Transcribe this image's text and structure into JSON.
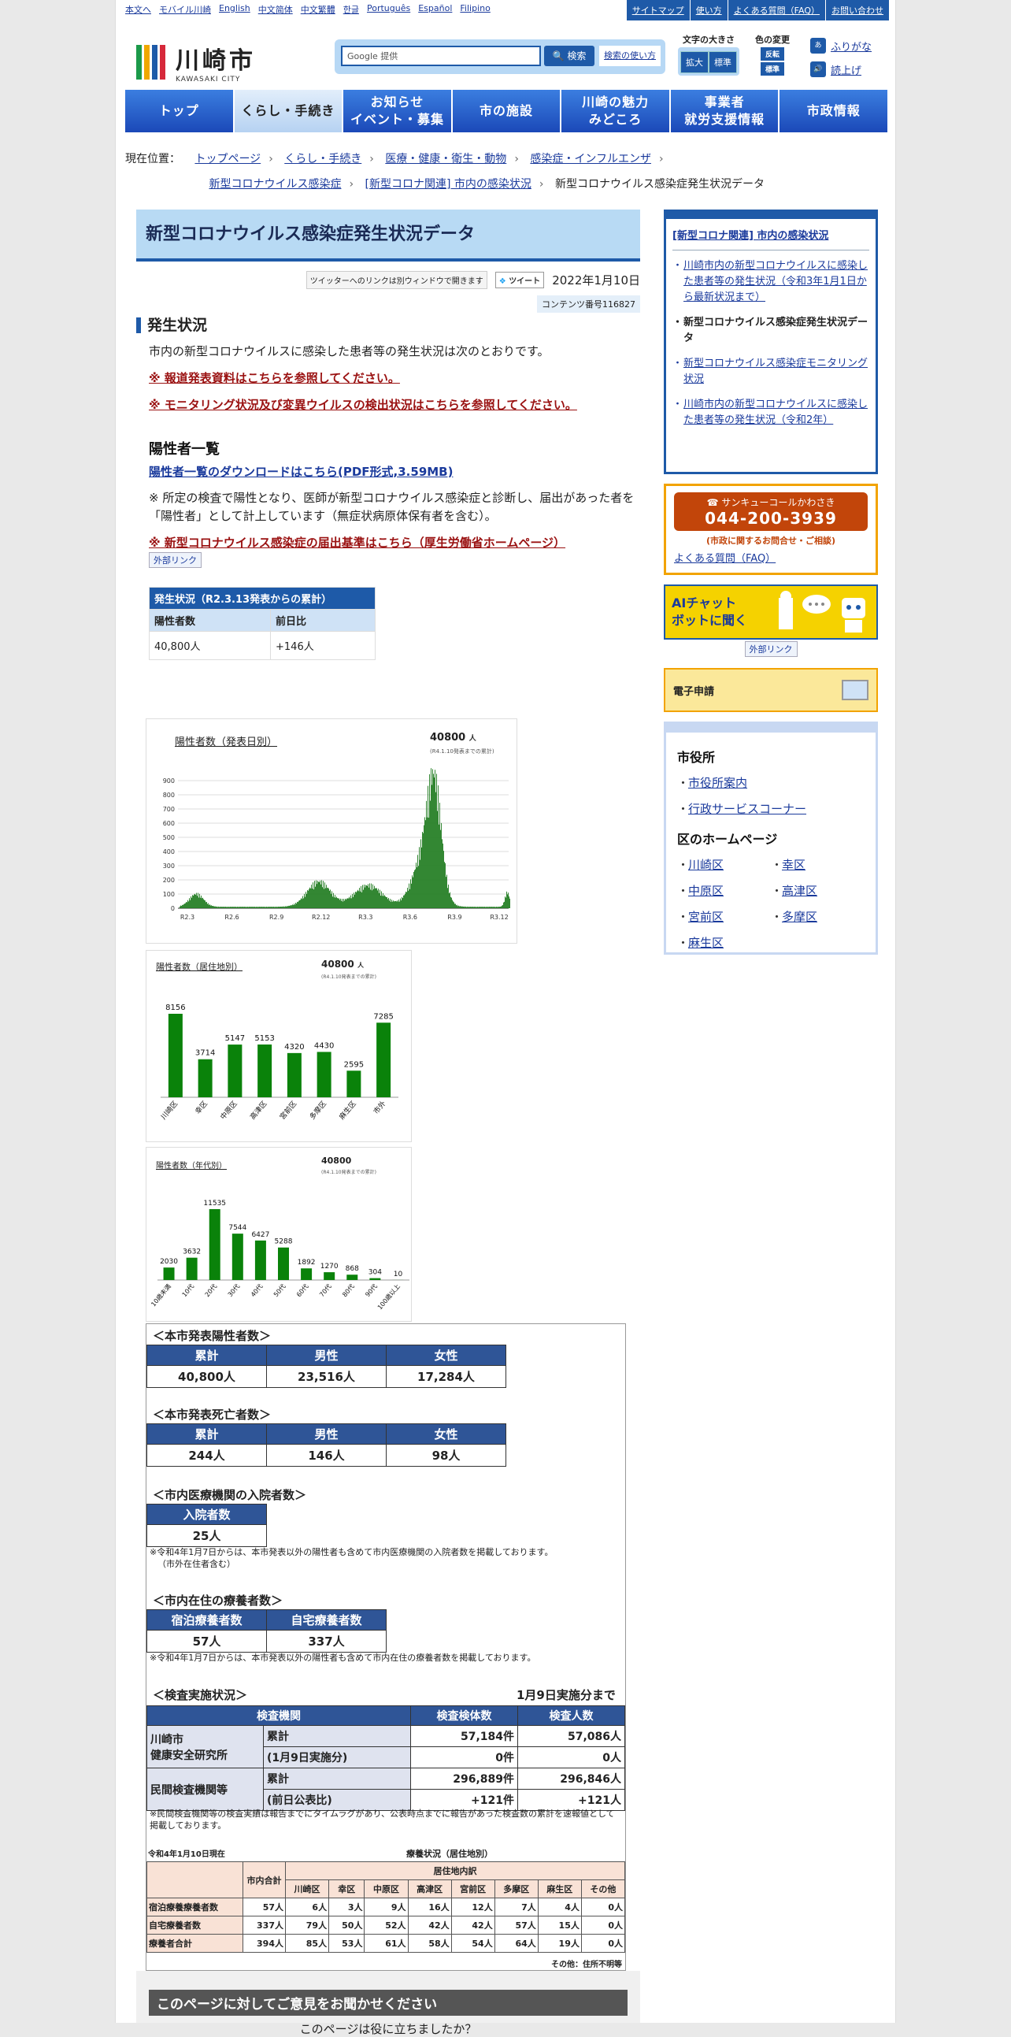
{
  "utility": {
    "left": [
      "本文へ",
      "モバイル川崎",
      "English",
      "中文简体",
      "中文繁體",
      "한글",
      "Português",
      "Español",
      "Filipino"
    ],
    "right": [
      "サイトマップ",
      "使い方",
      "よくある質問（FAQ）",
      "お問い合わせ"
    ]
  },
  "logo": {
    "name": "川崎市",
    "sub": "KAWASAKI CITY"
  },
  "search": {
    "placeholder": "Google 提供",
    "button": "検索",
    "help": "検索の使い方"
  },
  "fontsize": {
    "title": "文字の大きさ",
    "large": "拡大",
    "standard": "標準"
  },
  "colorchange": {
    "title": "色の変更",
    "reverse": "反転",
    "standard": "標準"
  },
  "ruby": {
    "furigana": "ふりがな",
    "read": "読上げ"
  },
  "nav": [
    "トップ",
    "くらし・手続き",
    "お知らせ\nイベント・募集",
    "市の施設",
    "川崎の魅力\nみどころ",
    "事業者\n就労支援情報",
    "市政情報"
  ],
  "breadcrumb": {
    "label": "現在位置：",
    "items": [
      "トップページ",
      "くらし・手続き",
      "医療・健康・衛生・動物",
      "感染症・インフルエンザ",
      "新型コロナウイルス感染症",
      "[新型コロナ関連] 市内の感染状況"
    ],
    "current": "新型コロナウイルス感染症発生状況データ"
  },
  "page": {
    "title": "新型コロナウイルス感染症発生状況データ",
    "twitter_note": "ツイッターへのリンクは別ウィンドウで開きます",
    "tweet": "ツイート",
    "date": "2022年1月10日",
    "content_no": "コンテンツ番号116827"
  },
  "status": {
    "heading": "発生状況",
    "intro": "市内の新型コロナウイルスに感染した患者等の発生状況は次のとおりです。",
    "link1": "※ 報道発表資料はこちらを参照してください。",
    "link2": "※ モニタリング状況及び変異ウイルスの検出状況はこちらを参照してください。"
  },
  "positive": {
    "heading": "陽性者一覧",
    "download": "陽性者一覧のダウンロードはこちら(PDF形式,3.59MB)",
    "note": "※ 所定の検査で陽性となり、医師が新型コロナウイルス感染症と診断し、届出があった者を「陽性者」として計上しています（無症状病原体保有者を含む）。",
    "criteria": "※ 新型コロナウイルス感染症の届出基準はこちら（厚生労働省ホームページ）",
    "ext": "外部リンク"
  },
  "summary": {
    "caption": "発生状況（R2.3.13発表からの累計）",
    "h1": "陽性者数",
    "h2": "前日比",
    "v1": "40,800人",
    "v2": "+146人"
  },
  "chart_data": [
    {
      "type": "bar",
      "title": "陽性者数（発表日別）",
      "total": "40800",
      "unit": "人",
      "note": "(R4.1.10発表までの累計)",
      "categories": [
        "R2.3",
        "R2.6",
        "R2.9",
        "R2.12",
        "R3.3",
        "R3.6",
        "R3.9",
        "R3.12"
      ],
      "ylim": [
        0,
        900
      ],
      "yticks": [
        0,
        100,
        200,
        300,
        400,
        500,
        600,
        700,
        800,
        900
      ]
    },
    {
      "type": "bar",
      "title": "陽性者数（居住地別）",
      "total": "40800",
      "unit": "人",
      "note": "(R4.1.10発表までの累計)",
      "categories": [
        "川崎区",
        "幸区",
        "中原区",
        "高津区",
        "宮前区",
        "多摩区",
        "麻生区",
        "市外"
      ],
      "values": [
        8156,
        3714,
        5147,
        5153,
        4320,
        4430,
        2595,
        7285
      ]
    },
    {
      "type": "bar",
      "title": "陽性者数（年代別）",
      "total": "40800",
      "unit": "人",
      "note": "(R4.1.10発表までの累計)",
      "categories": [
        "10歳未満",
        "10代",
        "20代",
        "30代",
        "40代",
        "50代",
        "60代",
        "70代",
        "80代",
        "90代",
        "100歳以上"
      ],
      "values": [
        2030,
        3632,
        11535,
        7544,
        6427,
        5288,
        1892,
        1270,
        868,
        304,
        10
      ]
    }
  ],
  "tables": {
    "pos": {
      "title": "＜本市発表陽性者数＞",
      "h": [
        "累計",
        "男性",
        "女性"
      ],
      "v": [
        "40,800人",
        "23,516人",
        "17,284人"
      ]
    },
    "death": {
      "title": "＜本市発表死亡者数＞",
      "h": [
        "累計",
        "男性",
        "女性"
      ],
      "v": [
        "244人",
        "146人",
        "98人"
      ]
    },
    "hosp": {
      "title": "＜市内医療機関の入院者数＞",
      "h": "入院者数",
      "v": "25人",
      "note": "※令和4年1月7日からは、本市発表以外の陽性者も含めて市内医療機関の入院者数を掲載しております。",
      "note2": "（市外在住者含む）"
    },
    "care": {
      "title": "＜市内在住の療養者数＞",
      "h": [
        "宿泊療養者数",
        "自宅療養者数"
      ],
      "v": [
        "57人",
        "337人"
      ],
      "note": "※令和4年1月7日からは、本市発表以外の陽性者も含めて市内在住の療養者数を掲載しております。"
    },
    "test": {
      "title": "＜検査実施状況＞",
      "asof": "1月9日実施分まで",
      "h": [
        "検査機関",
        "検査検体数",
        "検査人数"
      ],
      "org1": "川崎市\n健康安全研究所",
      "org2": "民間検査機関等",
      "sub": [
        "累計",
        "(1月9日実施分)",
        "累計",
        "(前日公表比)"
      ],
      "vals": [
        [
          "57,184件",
          "57,086人"
        ],
        [
          "0件",
          "0人"
        ],
        [
          "296,889件",
          "296,846人"
        ],
        [
          "+121件",
          "+121人"
        ]
      ],
      "note": "※民間検査機関等の検査実績は報告までにタイムラグがあり、公表時点までに報告があった検査数の累計を速報値として掲載しております。"
    },
    "city": {
      "asof": "令和4年1月10日現在",
      "title": "療養状況（居住地別）",
      "total": "市内合計",
      "breakdown": "居住地内訳",
      "cols": [
        "川崎区",
        "幸区",
        "中原区",
        "高津区",
        "宮前区",
        "多摩区",
        "麻生区",
        "その他"
      ],
      "rows": [
        {
          "label": "宿泊療養療養者数",
          "v": [
            "57人",
            "6人",
            "3人",
            "9人",
            "16人",
            "12人",
            "7人",
            "4人",
            "0人"
          ]
        },
        {
          "label": "自宅療養者数",
          "v": [
            "337人",
            "79人",
            "50人",
            "52人",
            "42人",
            "42人",
            "57人",
            "15人",
            "0人"
          ]
        },
        {
          "label": "療養者合計",
          "v": [
            "394人",
            "85人",
            "53人",
            "61人",
            "58人",
            "54人",
            "64人",
            "19人",
            "0人"
          ]
        }
      ],
      "foot": "その他：住所不明等"
    }
  },
  "feedback": {
    "head": "このページに対してご意見をお聞かせください",
    "sub": "このページは役に立ちましたか？"
  },
  "side": {
    "rel_head": "[新型コロナ関連] 市内の感染状況",
    "rel_items": [
      "川崎市内の新型コロナウイルスに感染した患者等の発生状況（令和3年1月1日から最新状況まで）",
      "新型コロナウイルス感染症発生状況データ",
      "新型コロナウイルス感染症モニタリング状況",
      "川崎市内の新型コロナウイルスに感染した患者等の発生状況（令和2年）"
    ],
    "sunq_name": "サンキューコールかわさき",
    "sunq_tel": "044-200-3939",
    "sunq_note": "(市政に関するお問合せ・ご相談)",
    "sunq_faq": "よくある質問（FAQ）",
    "ai": "AIチャット\nボットに聞く",
    "ai_ext": "外部リンク",
    "eapp": "電子申請",
    "cityhall": "市役所",
    "cityhall_items": [
      "市役所案内",
      "行政サービスコーナー"
    ],
    "wards": "区のホームページ",
    "ward_items": [
      "川崎区",
      "幸区",
      "中原区",
      "高津区",
      "宮前区",
      "多摩区",
      "麻生区"
    ]
  }
}
